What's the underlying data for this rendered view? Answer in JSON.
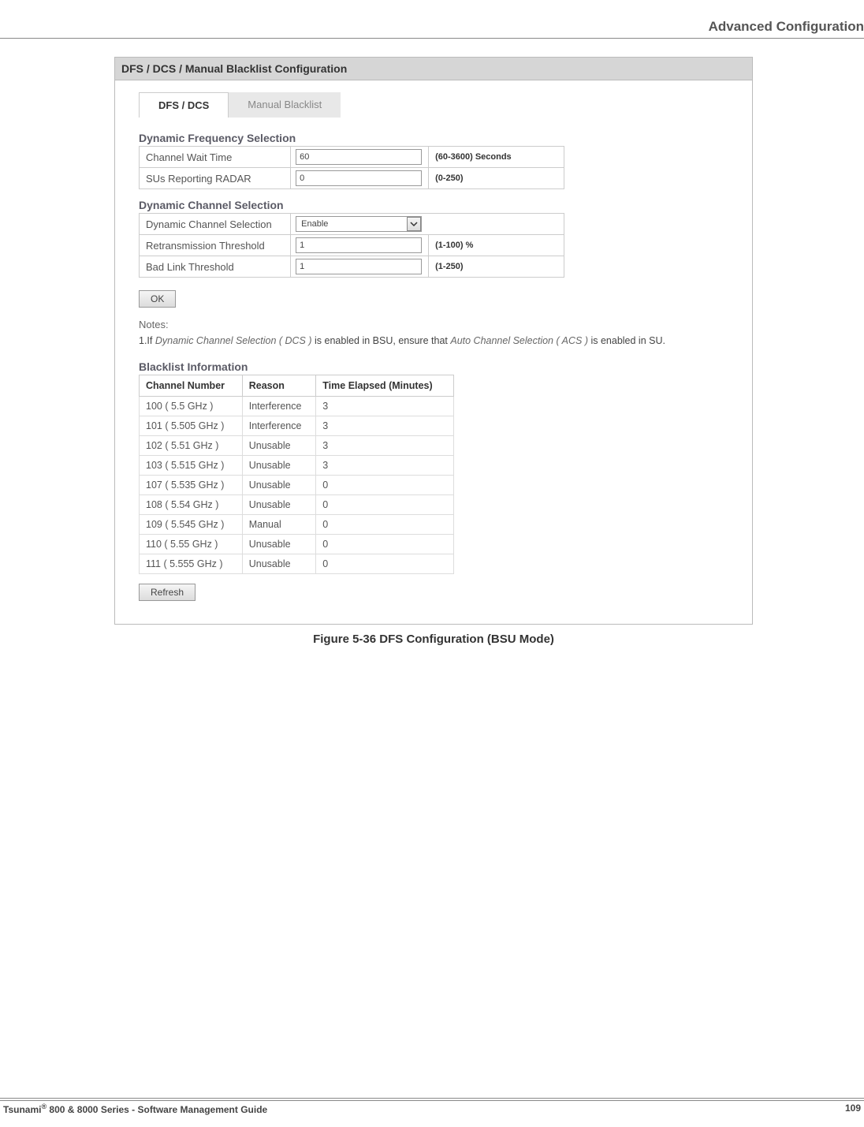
{
  "page": {
    "header_title": "Advanced Configuration",
    "figure_caption": "Figure 5-36 DFS Configuration (BSU Mode)",
    "footer_left_1": "Tsunami",
    "footer_left_sup": "®",
    "footer_left_2": " 800 & 8000 Series - Software Management Guide",
    "footer_right": "109"
  },
  "panel": {
    "title": "DFS / DCS / Manual Blacklist Configuration",
    "tabs": {
      "active": "DFS / DCS",
      "inactive": "Manual Blacklist"
    }
  },
  "dfs": {
    "heading": "Dynamic Frequency Selection",
    "rows": [
      {
        "label": "Channel Wait Time",
        "value": "60",
        "hint": "(60-3600) Seconds"
      },
      {
        "label": "SUs Reporting RADAR",
        "value": "0",
        "hint": "(0-250)"
      }
    ]
  },
  "dcs": {
    "heading": "Dynamic Channel Selection",
    "select_label": "Dynamic Channel Selection",
    "select_value": "Enable",
    "rows": [
      {
        "label": "Retransmission Threshold",
        "value": "1",
        "hint": "(1-100) %"
      },
      {
        "label": "Bad Link Threshold",
        "value": "1",
        "hint": "(1-250)"
      }
    ]
  },
  "buttons": {
    "ok": "OK",
    "refresh": "Refresh"
  },
  "notes": {
    "label": "Notes:",
    "n1_a": "1.If ",
    "n1_b": "Dynamic Channel Selection ( DCS )",
    "n1_c": " is enabled in BSU, ensure that ",
    "n1_d": "Auto Channel Selection ( ACS )",
    "n1_e": " is enabled in SU."
  },
  "blacklist": {
    "heading": "Blacklist Information",
    "headers": {
      "c1": "Channel Number",
      "c2": "Reason",
      "c3": "Time Elapsed (Minutes)"
    },
    "rows": [
      {
        "ch": "100  ( 5.5 GHz )",
        "reason": "Interference",
        "time": "3"
      },
      {
        "ch": "101  ( 5.505 GHz )",
        "reason": "Interference",
        "time": "3"
      },
      {
        "ch": "102  ( 5.51 GHz )",
        "reason": "Unusable",
        "time": "3"
      },
      {
        "ch": "103  ( 5.515 GHz )",
        "reason": "Unusable",
        "time": "3"
      },
      {
        "ch": "107  ( 5.535 GHz )",
        "reason": "Unusable",
        "time": "0"
      },
      {
        "ch": "108  ( 5.54 GHz )",
        "reason": "Unusable",
        "time": "0"
      },
      {
        "ch": "109  ( 5.545 GHz )",
        "reason": "Manual",
        "time": "0"
      },
      {
        "ch": "110  ( 5.55 GHz )",
        "reason": "Unusable",
        "time": "0"
      },
      {
        "ch": "111  ( 5.555 GHz )",
        "reason": "Unusable",
        "time": "0"
      }
    ]
  }
}
